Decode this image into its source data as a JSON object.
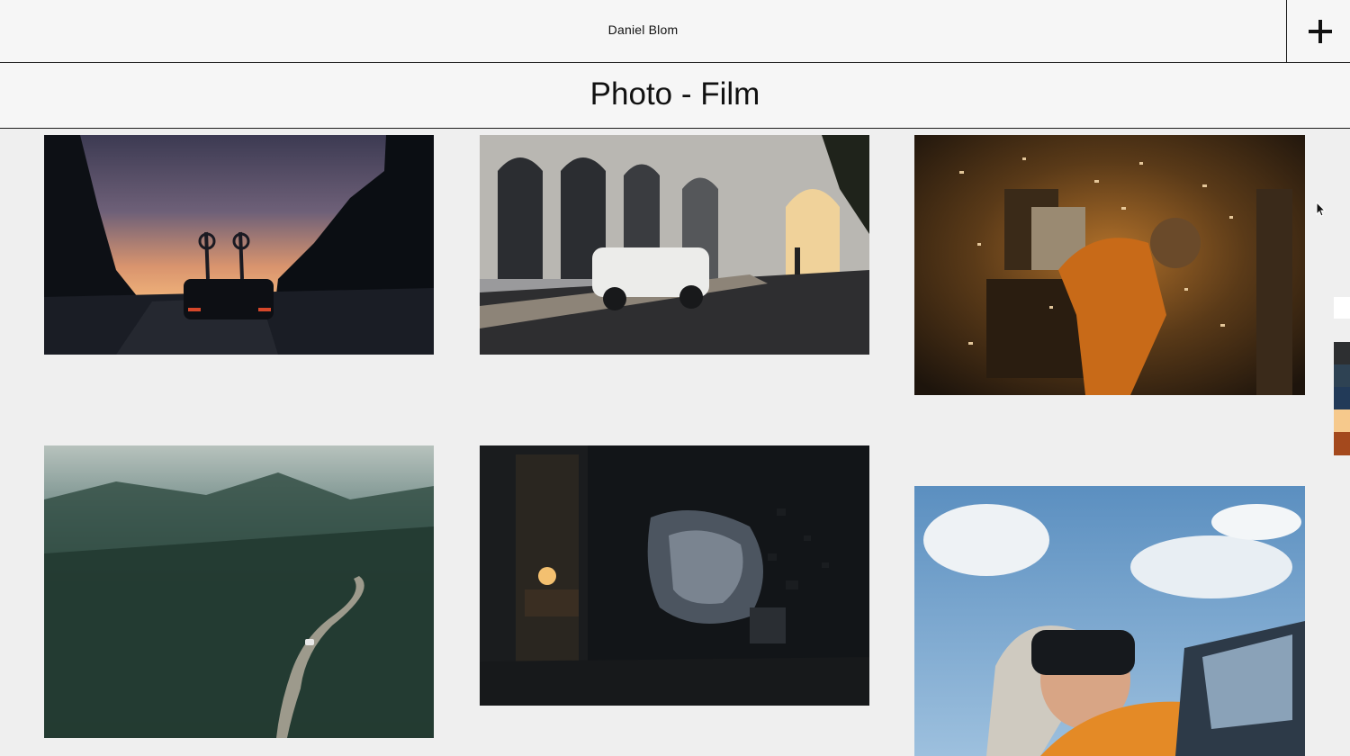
{
  "header": {
    "site_name": "Daniel Blom",
    "menu_icon": "plus-icon"
  },
  "page": {
    "title": "Photo - Film"
  },
  "gallery": [
    {
      "subject": "car with bike rack on mountain road at dusk"
    },
    {
      "subject": "white SUV beside arched colonnade"
    },
    {
      "subject": "figure in room with flying paper debris"
    },
    {
      "subject": "aerial forest with winding road"
    },
    {
      "subject": "dark room with man bursting through wall"
    },
    {
      "subject": "man in VR headset leaning out of car window"
    }
  ],
  "swatches": [
    "#ffffff",
    "#2d2f31",
    "#2e4253",
    "#223a58",
    "#f6c98c",
    "#a4491d"
  ],
  "cursor_icon": "arrow-cursor-icon"
}
